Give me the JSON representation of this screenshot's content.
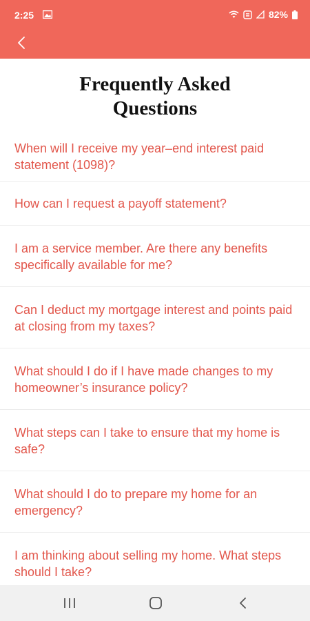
{
  "status_bar": {
    "time": "2:25",
    "battery": "82%",
    "icons": [
      "image-icon",
      "wifi-icon",
      "data-sync-icon",
      "signal-icon",
      "battery-icon"
    ]
  },
  "header": {
    "back_icon": "chevron-left-icon",
    "color": "#f0675a"
  },
  "page": {
    "title_line1": "Frequently Asked",
    "title_line2": "Questions"
  },
  "faq": {
    "accent_color": "#e2574c",
    "items": [
      {
        "question": "When will I receive my year–end interest paid statement (1098)?"
      },
      {
        "question": "How can I request a payoff statement?"
      },
      {
        "question": "I am a service member. Are there any benefits specifically available for me?"
      },
      {
        "question": "Can I deduct my mortgage interest and points paid at closing from my taxes?"
      },
      {
        "question": "What should I do if I have made changes to my homeowner’s insurance policy?"
      },
      {
        "question": "What steps can I take to ensure that my home is safe?"
      },
      {
        "question": "What should I do to prepare my home for an emergency?"
      },
      {
        "question": "I am thinking about selling my home. What steps should I take?"
      }
    ]
  },
  "nav_bar": {
    "icons": [
      "recent-apps-icon",
      "home-icon",
      "back-icon"
    ]
  }
}
